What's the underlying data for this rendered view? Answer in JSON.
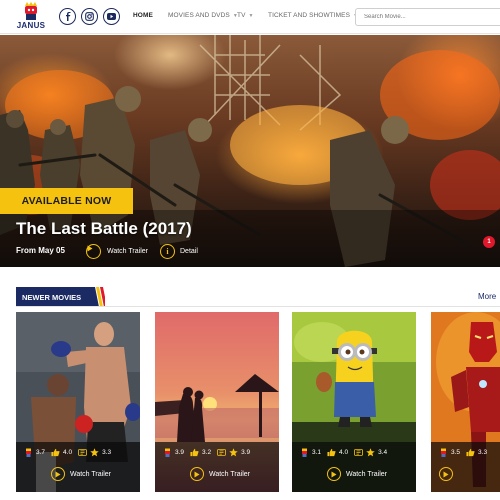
{
  "header": {
    "logo_text": "JANUS",
    "nav": [
      {
        "label": "HOME",
        "active": true,
        "has_dropdown": false
      },
      {
        "label": "MOVIES AND DVDS",
        "active": false,
        "has_dropdown": true
      },
      {
        "label": "TV",
        "active": false,
        "has_dropdown": true
      },
      {
        "label": "TICKET AND SHOWTIMES",
        "active": false,
        "has_dropdown": true
      }
    ],
    "social_icons": [
      "facebook-icon",
      "instagram-icon",
      "youtube-icon"
    ],
    "search_placeholder": "Search Movie..."
  },
  "hero": {
    "badge": "AVAILABLE NOW",
    "title": "The Last Battle (2017)",
    "date": "From May 05",
    "watch_trailer": "Watch Trailer",
    "detail": "Detail",
    "notification_count": "1"
  },
  "section": {
    "title": "NEWER MOVIES",
    "more_label": "More"
  },
  "cards": [
    {
      "ratings": [
        "3.7",
        "4.0",
        "3.3"
      ],
      "trailer": "Watch Trailer"
    },
    {
      "ratings": [
        "3.9",
        "3.2",
        "3.9"
      ],
      "trailer": "Watch Trailer"
    },
    {
      "ratings": [
        "3.1",
        "4.0",
        "3.4"
      ],
      "trailer": "Watch Trailer"
    },
    {
      "ratings": [
        "3.5",
        "3.3",
        ""
      ],
      "trailer": ""
    }
  ],
  "colors": {
    "accent": "#f4c20f",
    "navy": "#1c2a63",
    "red": "#e0182b"
  }
}
